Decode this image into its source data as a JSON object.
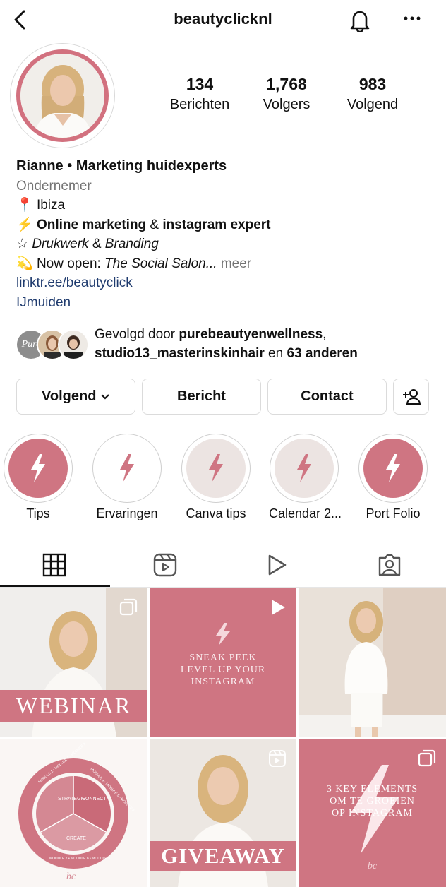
{
  "header": {
    "title": "beautyclicknl"
  },
  "profile": {
    "stats": [
      {
        "value": "134",
        "label": "Berichten"
      },
      {
        "value": "1,768",
        "label": "Volgers"
      },
      {
        "value": "983",
        "label": "Volgend"
      }
    ],
    "name": "Rianne • Marketing huidexperts",
    "category": "Ondernemer",
    "bio": {
      "line1_icon": "📍",
      "line1": "Ibiza",
      "line2_icon": "⚡",
      "line2_bold1": "Online marketing",
      "line2_mid": " & ",
      "line2_bold2": "instagram expert",
      "line3_icon": "☆",
      "line3_italic1": "Drukwerk",
      "line3_mid": " & ",
      "line3_italic2": "Branding",
      "line4_icon": "💫",
      "line4_text": "Now open: ",
      "line4_italic": "The Social Salon...",
      "line4_more": " meer"
    },
    "link": "linktr.ee/beautyclick",
    "location": "IJmuiden"
  },
  "followed_by": {
    "prefix": "Gevolgd door ",
    "user1": "purebeautyenwellness",
    "sep": ",",
    "user2": "studio13_masterinskinhair",
    "mid": " en ",
    "others": "63 anderen",
    "avatar_text": "Pure"
  },
  "actions": {
    "following": "Volgend",
    "message": "Bericht",
    "contact": "Contact"
  },
  "highlights": [
    {
      "label": "Tips",
      "color": "#cf7582"
    },
    {
      "label": "Ervaringen",
      "color": "#ffffff"
    },
    {
      "label": "Canva tips",
      "color": "#ece4e2"
    },
    {
      "label": "Calendar 2...",
      "color": "#ece4e2"
    },
    {
      "label": "Port Folio",
      "color": "#cf7582"
    }
  ],
  "grid": {
    "post1_text": "WEBINAR",
    "post2_lines": [
      "SNEAK PEEK",
      "LEVEL UP YOUR",
      "INSTAGRAM"
    ],
    "post4_labels": [
      "STRATEGIE",
      "CONNECT",
      "CREATE"
    ],
    "post4_modules": [
      "MODULE 1 • MODULE 2 • MODULE 3",
      "MODULE 4 • MODULE 5 • MODULE 6",
      "MODULE 7 • MODULE 8 • MODULE 9"
    ],
    "post5_text": "GIVEAWAY",
    "post6_lines": [
      "3 KEY ELEMENTS",
      "OM TE GROEIEN",
      "OP INSTAGRAM"
    ],
    "signature": "bc"
  },
  "colors": {
    "brand_pink": "#cf7582",
    "link": "#1f3b6e"
  }
}
